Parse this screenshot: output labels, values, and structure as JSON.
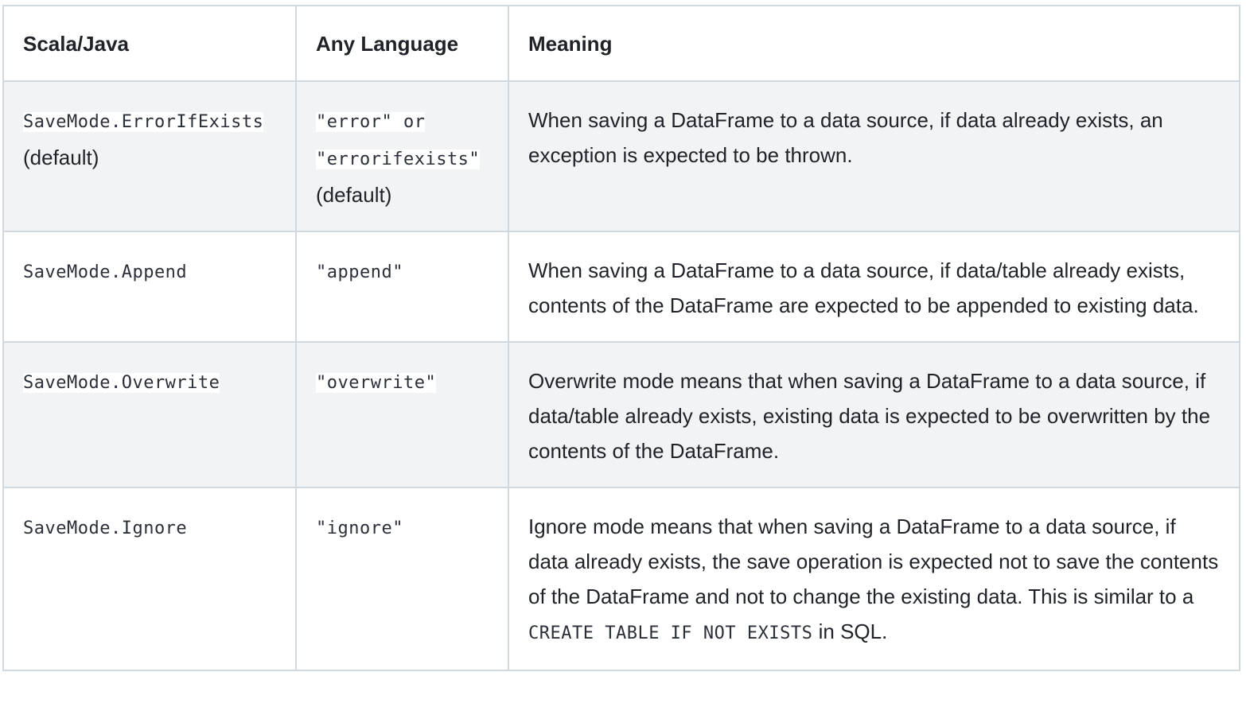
{
  "table": {
    "headers": [
      "Scala/Java",
      "Any Language",
      "Meaning"
    ],
    "rows": [
      {
        "scala_java": {
          "code": "SaveMode.ErrorIfExists",
          "note": "(default)"
        },
        "any_language": {
          "code_1": "\"error\" or",
          "code_2": "\"errorifexists\"",
          "note": "(default)"
        },
        "meaning": {
          "text": "When saving a DataFrame to a data source, if data already exists, an exception is expected to be thrown."
        }
      },
      {
        "scala_java": {
          "code": "SaveMode.Append"
        },
        "any_language": {
          "code_1": "\"append\""
        },
        "meaning": {
          "text": "When saving a DataFrame to a data source, if data/table already exists, contents of the DataFrame are expected to be appended to existing data."
        }
      },
      {
        "scala_java": {
          "code": "SaveMode.Overwrite"
        },
        "any_language": {
          "code_1": "\"overwrite\""
        },
        "meaning": {
          "text": "Overwrite mode means that when saving a DataFrame to a data source, if data/table already exists, existing data is expected to be overwritten by the contents of the DataFrame."
        }
      },
      {
        "scala_java": {
          "code": "SaveMode.Ignore"
        },
        "any_language": {
          "code_1": "\"ignore\""
        },
        "meaning": {
          "text": "Ignore mode means that when saving a DataFrame to a data source, if data already exists, the save operation is expected not to save the contents of the DataFrame and not to change the existing data. This is similar to a",
          "code": "CREATE TABLE IF NOT EXISTS",
          "suffix": "in SQL."
        }
      }
    ]
  }
}
